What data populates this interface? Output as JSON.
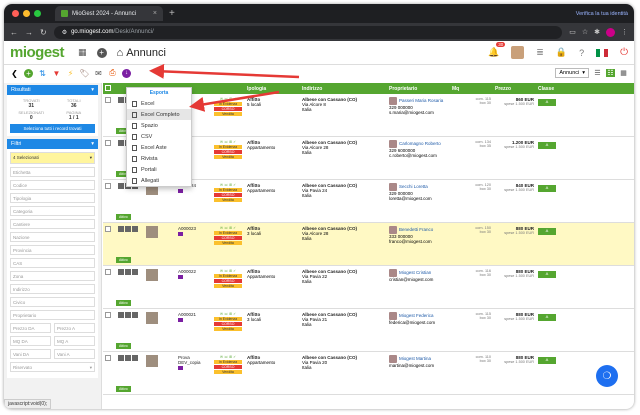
{
  "browser": {
    "tab_title": "MioGest 2024 - Annunci",
    "new_tab": "+",
    "verify_text": "Verifica la tua identità",
    "url_host": "go.miogest.com",
    "url_path": "/Desk/Annunci/"
  },
  "app": {
    "logo": "miogest",
    "page_title": "Annunci",
    "notification_count": "30",
    "accent": "#55a630"
  },
  "toolbar": {
    "view_select": "Annunci"
  },
  "export_menu": {
    "header": "Esporta",
    "items": [
      "Excel",
      "Excel Completo",
      "Spazio",
      "CSV",
      "Excel Aste",
      "Rivista",
      "Portali",
      "Allegati"
    ],
    "active_index": 1
  },
  "sidebar": {
    "results_title": "Risultati",
    "stats": [
      {
        "label": "TROVATI",
        "value": "31"
      },
      {
        "label": "TOTALI",
        "value": "36"
      },
      {
        "label": "SELEZIONATI",
        "value": "0"
      },
      {
        "label": "PAGINA",
        "value": "1 / 1"
      }
    ],
    "select_all": "Seleziona tutti i record trovati",
    "filters_title": "Filtri",
    "selected_filter": "4 Selezionati",
    "fields": [
      "Etichetta",
      "Codice",
      "Tipologia",
      "Categoria",
      "Cantiere",
      "Nazione",
      "Provincia",
      "CAS",
      "Zona",
      "Indirizzo",
      "Civico",
      "Proprietario"
    ],
    "pairs": [
      [
        "Prezzo DA",
        "Prezzo A"
      ],
      [
        "MQ DA",
        "MQ A"
      ],
      [
        "Vani DA",
        "Vani A"
      ]
    ],
    "last_field": "Riservato"
  },
  "table": {
    "headers": [
      "",
      "",
      "Ipologia",
      "Indirizzo",
      "Proprietario",
      "Mq",
      "Prezzo",
      "Classe"
    ],
    "rows": [
      {
        "code": "",
        "type": "Affitto",
        "subtype": "5 locali",
        "city": "Albese con Cassano (CO)",
        "street": "Via Alcore 8",
        "country": "Italia",
        "owner": "Passeri Maria Rosaria",
        "phone": "329 000000",
        "email": "s.maria@miogest.com",
        "mq": "com. 115",
        "mq2": "box 30",
        "price": "860 EUR",
        "price2": "spese 1.500 EUR",
        "classe": "A",
        "highlight": false
      },
      {
        "code": "",
        "type": "Affitto",
        "subtype": "Appartamento",
        "city": "Albese con Cassano (CO)",
        "street": "Via Alcore 28",
        "country": "Italia",
        "owner": "Carlomagno Roberto",
        "phone": "329 6000000",
        "email": "c.roberto@miogest.com",
        "mq": "com. 134",
        "mq2": "box 35",
        "price": "1.200 EUR",
        "price2": "spese 1.500 EUR",
        "classe": "A",
        "highlight": false
      },
      {
        "code": "A000024",
        "type": "Affitto",
        "subtype": "Appartamento",
        "city": "Albese con Cassano (CO)",
        "street": "Via Pavia 24",
        "country": "Italia",
        "owner": "Secchi Loretta",
        "phone": "329 000000",
        "email": "loretta@miogest.com",
        "mq": "com. 120",
        "mq2": "box 30",
        "price": "840 EUR",
        "price2": "spese 1.500 EUR",
        "classe": "A",
        "highlight": false
      },
      {
        "code": "A000023",
        "type": "Affitto",
        "subtype": "3 locali",
        "city": "Albese con Cassano (CO)",
        "street": "Via Alcore 28",
        "country": "Italia",
        "owner": "Benedetti Franco",
        "phone": "333 000000",
        "email": "franco@miogest.com",
        "mq": "com. 150",
        "mq2": "box 30",
        "price": "880 EUR",
        "price2": "spese 1.500 EUR",
        "classe": "A",
        "highlight": true
      },
      {
        "code": "A000022",
        "type": "Affitto",
        "subtype": "Appartamento",
        "city": "Albese con Cassano (CO)",
        "street": "Via Pavia 22",
        "country": "Italia",
        "owner": "Miogest Cristian",
        "phone": "",
        "email": "cristian@miogest.com",
        "mq": "com. 116",
        "mq2": "box 30",
        "price": "880 EUR",
        "price2": "spese 1.500 EUR",
        "classe": "A",
        "highlight": false
      },
      {
        "code": "A000021",
        "type": "Affitto",
        "subtype": "3 locali",
        "city": "Albese con Cassano (CO)",
        "street": "Via Pavia 21",
        "country": "Italia",
        "owner": "Miogest Federica",
        "phone": "",
        "email": "federica@miogest.com",
        "mq": "com. 115",
        "mq2": "box 30",
        "price": "880 EUR",
        "price2": "spese 1.500 EUR",
        "classe": "A",
        "highlight": false
      },
      {
        "code": "Prova DEV_copia",
        "type": "Affitto",
        "subtype": "Appartamento",
        "city": "Albese con Cassano (CO)",
        "street": "Via Pavia 20",
        "country": "Italia",
        "owner": "Miogest Martina",
        "phone": "",
        "email": "martina@miogest.com",
        "mq": "com. 110",
        "mq2": "box 30",
        "price": "880 EUR",
        "price2": "spese 1.500 EUR",
        "classe": "A",
        "highlight": false
      }
    ],
    "status_labels": {
      "attivo": "Attivo",
      "vendita": "Vendita",
      "incorso": "In Evidenza",
      "corso": "CORSO"
    }
  },
  "statusbar": "javascript:void(0);"
}
